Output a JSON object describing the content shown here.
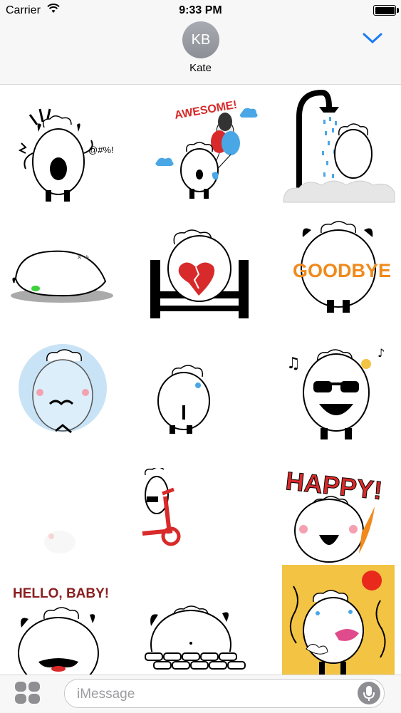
{
  "status_bar": {
    "carrier": "Carrier",
    "time": "9:33 PM"
  },
  "header": {
    "avatar_initials": "KB",
    "contact_name": "Kate"
  },
  "stickers": [
    {
      "name": "angry-shout",
      "text": "@#%!"
    },
    {
      "name": "awesome-balloons",
      "text": "AWESOME!"
    },
    {
      "name": "shower",
      "text": ""
    },
    {
      "name": "lying-sick",
      "text": ""
    },
    {
      "name": "broken-heart-bench",
      "text": ""
    },
    {
      "name": "goodbye",
      "text": "GOODBYE"
    },
    {
      "name": "frozen-bubble",
      "text": ""
    },
    {
      "name": "crying",
      "text": ""
    },
    {
      "name": "sunglasses-music",
      "text": ""
    },
    {
      "name": "fading",
      "text": ""
    },
    {
      "name": "scooter",
      "text": ""
    },
    {
      "name": "happy",
      "text": "HAPPY!"
    },
    {
      "name": "hello-baby",
      "text": "HELLO, BABY!"
    },
    {
      "name": "peeking-wall",
      "text": ""
    },
    {
      "name": "sweating-hot",
      "text": ""
    }
  ],
  "input": {
    "placeholder": "iMessage"
  },
  "colors": {
    "accent": "#1a7cf5",
    "red": "#d82a2a",
    "orange": "#f08a1c",
    "yellow": "#f3c343",
    "blue": "#4aa7e6"
  },
  "icons": [
    "wifi-icon",
    "battery-icon",
    "chevron-down-icon",
    "app-drawer-icon",
    "microphone-icon"
  ]
}
